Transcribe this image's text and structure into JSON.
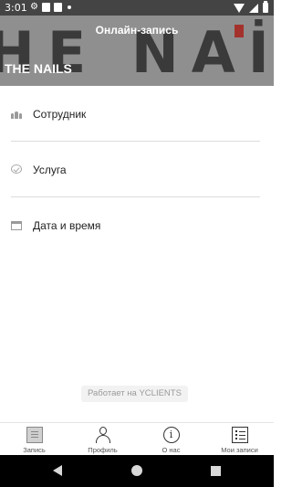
{
  "status_bar": {
    "time": "3:01"
  },
  "header": {
    "title": "Онлайн-запись",
    "banner_text": "HE NAİ",
    "brand": "THE NAILS"
  },
  "menu": {
    "items": [
      {
        "label": "Сотрудник",
        "icon": "people-icon"
      },
      {
        "label": "Услуга",
        "icon": "check-circle-icon"
      },
      {
        "label": "Дата и время",
        "icon": "calendar-icon"
      }
    ]
  },
  "powered_by": "Работает на YCLIENTS",
  "bottom_nav": {
    "items": [
      {
        "label": "Запись",
        "icon": "notes-icon"
      },
      {
        "label": "Профиль",
        "icon": "profile-icon"
      },
      {
        "label": "О нас",
        "icon": "info-icon"
      },
      {
        "label": "Мои записи",
        "icon": "list-icon"
      }
    ]
  },
  "colors": {
    "header_bg": "#8f8f8f",
    "status_bar": "#444444",
    "accent": "#a4322c"
  }
}
